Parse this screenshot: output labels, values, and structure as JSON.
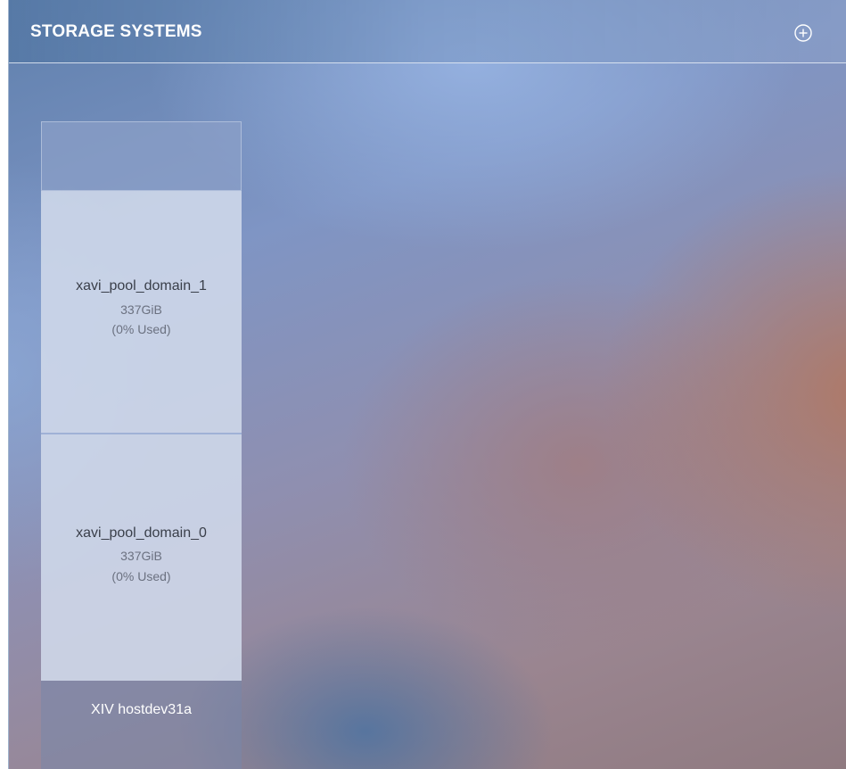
{
  "header": {
    "title": "STORAGE SYSTEMS",
    "add_icon": "plus-circle-icon"
  },
  "system": {
    "name": "XIV hostdev31a",
    "pools": [
      {
        "name": "xavi_pool_domain_1",
        "size": "337GiB",
        "usage": "(0% Used)"
      },
      {
        "name": "xavi_pool_domain_0",
        "size": "337GiB",
        "usage": "(0% Used)"
      }
    ]
  },
  "colors": {
    "header_text": "#ffffff",
    "pool_name_text": "#3a3f4a",
    "pool_sub_text": "#6b7180"
  }
}
